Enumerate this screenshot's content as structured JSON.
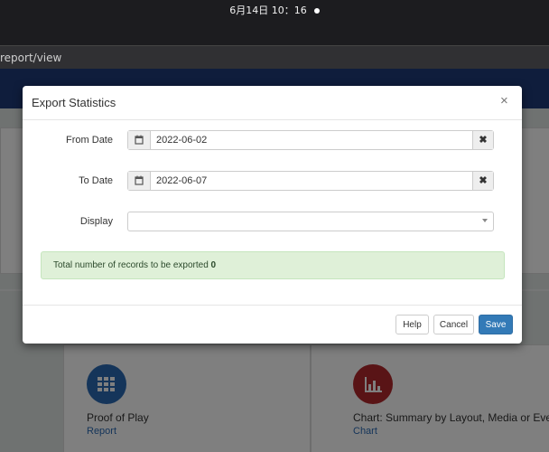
{
  "system": {
    "clock": "6月14日 10：16"
  },
  "browser": {
    "url_fragment": "report/view"
  },
  "modal": {
    "title": "Export Statistics",
    "close_symbol": "×",
    "from_date": {
      "label": "From Date",
      "value": "2022-06-02",
      "clear_symbol": "✖"
    },
    "to_date": {
      "label": "To Date",
      "value": "2022-06-07",
      "clear_symbol": "✖"
    },
    "display": {
      "label": "Display",
      "value": ""
    },
    "alert": {
      "text": "Total number of records to be exported",
      "count": "0"
    },
    "buttons": {
      "help": "Help",
      "cancel": "Cancel",
      "save": "Save"
    }
  },
  "background_tiles": [
    {
      "title": "Proof of Play",
      "link": "Report",
      "icon": "grid-icon",
      "color": "#2a6ab4"
    },
    {
      "title": "Chart: Summary by Layout, Media or Event",
      "link": "Chart",
      "icon": "bar-chart-icon",
      "color": "#b3282d"
    }
  ]
}
